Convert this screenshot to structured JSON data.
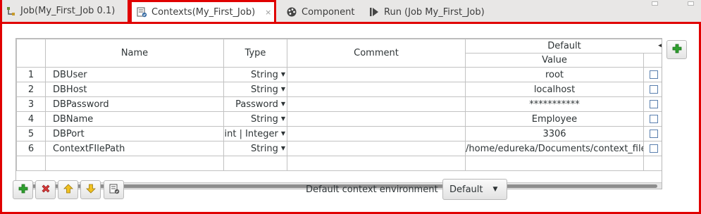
{
  "tabs": [
    {
      "label": "Job(My_First_Job 0.1)",
      "icon": "job-icon"
    },
    {
      "label": "Contexts(My_First_Job)",
      "icon": "contexts-icon",
      "close": "×"
    },
    {
      "label": "Component",
      "icon": "component-palette-icon"
    },
    {
      "label": "Run (Job My_First_Job)",
      "icon": "run-icon"
    }
  ],
  "table": {
    "headers": {
      "name": "Name",
      "type": "Type",
      "comment": "Comment",
      "group": "Default",
      "value": "Value"
    },
    "rows": [
      {
        "index": "1",
        "name": "DBUser",
        "type": "String",
        "comment": "",
        "value": "root"
      },
      {
        "index": "2",
        "name": "DBHost",
        "type": "String",
        "comment": "",
        "value": "localhost"
      },
      {
        "index": "3",
        "name": "DBPassword",
        "type": "Password",
        "comment": "",
        "value": "***********"
      },
      {
        "index": "4",
        "name": "DBName",
        "type": "String",
        "comment": "",
        "value": "Employee"
      },
      {
        "index": "5",
        "name": "DBPort",
        "type": "int | Integer",
        "comment": "",
        "value": "3306"
      },
      {
        "index": "6",
        "name": "ContextFIlePath",
        "type": "String",
        "comment": "",
        "value": "/home/edureka/Documents/context_file"
      }
    ]
  },
  "toolbar": {
    "icons": [
      "add-icon",
      "delete-icon",
      "move-up-icon",
      "move-down-icon",
      "context-manage-icon"
    ]
  },
  "environment": {
    "label": "Default context environment",
    "selected": "Default"
  },
  "colors": {
    "highlight": "#e00000",
    "add_green": "#2ea02e",
    "delete_red": "#d83a3a",
    "arrow_yellow": "#f0c020"
  }
}
